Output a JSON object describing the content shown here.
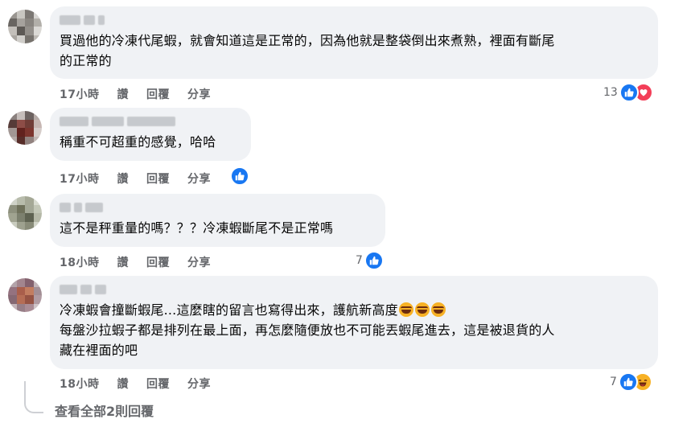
{
  "comments": [
    {
      "text": "買過他的冷凍代尾蝦，就會知道這是正常的，因為他就是整袋倒出來煮熟，裡面有斷尾\n的正常的",
      "time": "17小時",
      "read": "讚",
      "reply": "回覆",
      "share": "分享",
      "reaction_count": "13",
      "reactions": [
        "like-icon",
        "love-icon"
      ]
    },
    {
      "text": "稱重不可超重的感覺，哈哈",
      "time": "17小時",
      "read": "讚",
      "reply": "回覆",
      "share": "分享",
      "reaction_count": "",
      "reactions": [
        "like-icon"
      ]
    },
    {
      "text": "這不是秤重量的嗎？？？冷凍蝦斷尾不是正常嗎",
      "time": "18小時",
      "read": "讚",
      "reply": "回覆",
      "share": "分享",
      "reaction_count": "7",
      "reactions": [
        "like-icon"
      ]
    },
    {
      "text_line1": "冷凍蝦會撞斷蝦尾...這麼瞎的留言也寫得出來，護航新高度",
      "text_rest": "每盤沙拉蝦子都是排列在最上面，再怎麼隨便放也不可能丟蝦尾進去，這是被退貨的人\n藏在裡面的吧",
      "time": "18小時",
      "read": "讚",
      "reply": "回覆",
      "share": "分享",
      "reaction_count": "7",
      "reactions": [
        "like-icon",
        "haha-icon"
      ]
    }
  ],
  "view_replies": "查看全部2則回覆",
  "colors": {
    "like": "#1877f2",
    "love": "#f33e58",
    "haha": "#f7b125",
    "bubble": "#f0f2f5",
    "meta": "#65676b"
  }
}
